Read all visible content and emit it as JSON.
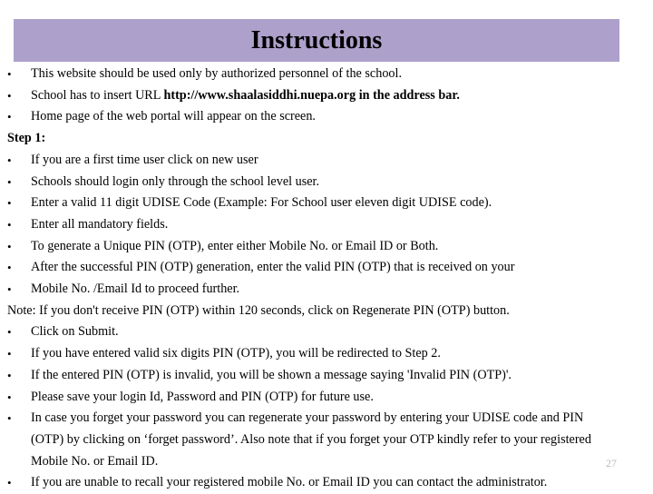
{
  "slide": {
    "title": "Instructions",
    "banner_color": "#ada0cb",
    "page_number": "27",
    "lines": [
      {
        "id": "l1",
        "bullet": "•",
        "text": "This website should be used only by authorized personnel of the school."
      },
      {
        "id": "l2",
        "bullet": "•",
        "text_pre": "School has to insert URL ",
        "text_bold": "http://www.shaalasiddhi.nuepa.org in the address bar."
      },
      {
        "id": "l3",
        "bullet": "•",
        "text": "Home page of the web portal will appear on the screen."
      },
      {
        "id": "l4",
        "bullet": "",
        "text": "Step 1:"
      },
      {
        "id": "l5",
        "bullet": "•",
        "text": "If you are a first time user click on new user"
      },
      {
        "id": "l6",
        "bullet": "•",
        "text": "Schools should login only through the school level user."
      },
      {
        "id": "l7",
        "bullet": "•",
        "text": "Enter a valid 11 digit UDISE Code (Example: For School user eleven digit UDISE code)."
      },
      {
        "id": "l8",
        "bullet": "•",
        "text": "Enter all mandatory fields."
      },
      {
        "id": "l9",
        "bullet": "•",
        "text": "To generate a Unique PIN (OTP), enter either Mobile No. or Email ID or Both."
      },
      {
        "id": "l10",
        "bullet": "•",
        "text": "After the successful PIN (OTP) generation, enter the valid PIN (OTP) that is received on your"
      },
      {
        "id": "l11",
        "bullet": "•",
        "text": " Mobile No. /Email Id to proceed further."
      },
      {
        "id": "l12",
        "bullet": "",
        "text": "Note: If you don't receive PIN (OTP) within 120 seconds, click on Regenerate PIN (OTP) button."
      },
      {
        "id": "l13",
        "bullet": "•",
        "text": "Click on Submit."
      },
      {
        "id": "l14",
        "bullet": "•",
        "text": "If you have entered valid six digits PIN (OTP), you will be redirected to Step 2."
      },
      {
        "id": "l15",
        "bullet": "•",
        "text": "If the entered PIN (OTP) is invalid, you will be shown a message saying 'Invalid PIN (OTP)'."
      },
      {
        "id": "l16",
        "bullet": "•",
        "text": "Please save your login Id, Password and PIN (OTP) for future use."
      },
      {
        "id": "l17",
        "bullet": "•",
        "text": "In case you forget your password you can regenerate your password by entering your UDISE code and PIN (OTP) by clicking on ‘forget password’. Also note that if you forget your OTP kindly refer to your registered Mobile No. or Email ID."
      },
      {
        "id": "l18",
        "bullet": "•",
        "text": "If you are unable to recall your registered mobile No. or Email ID you can contact the administrator."
      }
    ]
  }
}
